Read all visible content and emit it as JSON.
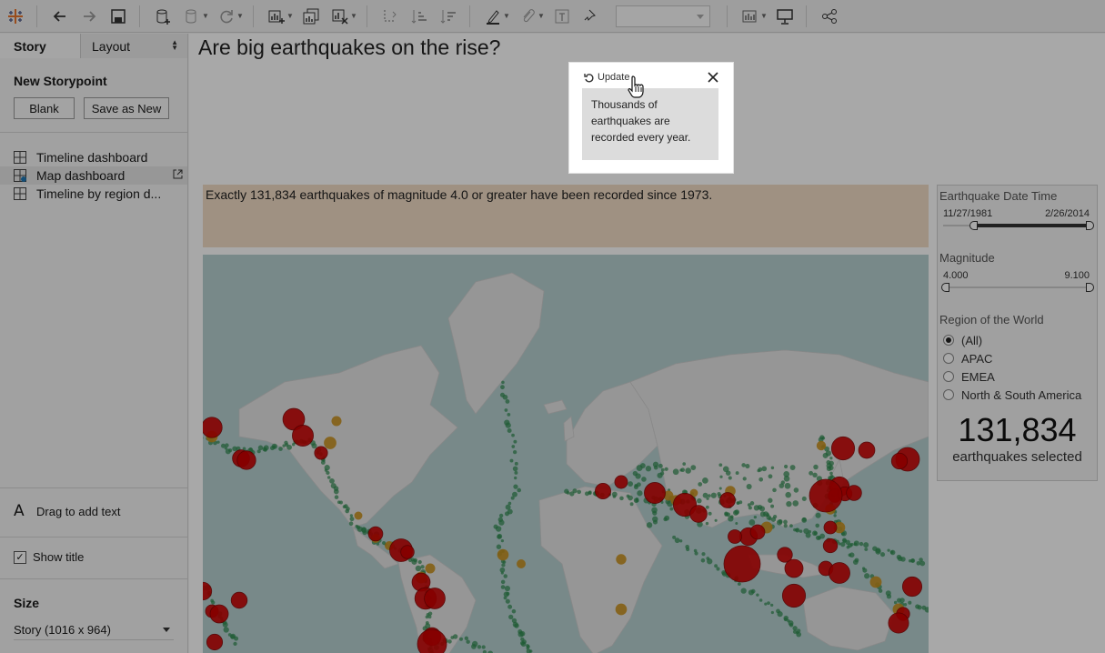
{
  "toolbar": {
    "icons": [
      "tableau-logo-icon",
      "undo-icon",
      "redo-icon",
      "save-icon",
      "new-data-source-icon",
      "pause-updates-icon",
      "refresh-icon",
      "new-worksheet-icon",
      "duplicate-sheet-icon",
      "clear-sheet-icon",
      "swap-rows-columns-icon",
      "sort-ascending-icon",
      "sort-descending-icon",
      "highlight-icon",
      "group-members-icon",
      "show-labels-icon",
      "fix-axes-icon",
      "fit-select",
      "show-me-icon",
      "presentation-mode-icon",
      "share-icon"
    ]
  },
  "left_pane": {
    "tabs": {
      "story": "Story",
      "layout": "Layout"
    },
    "new_storypoint": {
      "title": "New Storypoint",
      "blank": "Blank",
      "save_as_new": "Save as New"
    },
    "sheets": [
      {
        "label": "Timeline dashboard"
      },
      {
        "label": "Map dashboard"
      },
      {
        "label": "Timeline by region d..."
      }
    ],
    "drag_text": "Drag to add text",
    "show_title": "Show title",
    "show_title_checked": true,
    "size": {
      "title": "Size",
      "value": "Story (1016 x 964)"
    }
  },
  "story": {
    "title": "Are big earthquakes on the rise?",
    "caption_text": "Exactly 131,834 earthquakes of magnitude 4.0 or greater have been recorded since 1973.",
    "popup": {
      "update_label": "Update",
      "text": "Thousands of earthquakes are recorded every year."
    },
    "filters": {
      "date_title": "Earthquake Date Time",
      "date_min": "11/27/1981",
      "date_max": "2/26/2014",
      "date_level_min": 0.18,
      "mag_title": "Magnitude",
      "mag_min": "4.000",
      "mag_max": "9.100",
      "region_title": "Region of the World",
      "regions": [
        "(All)",
        "APAC",
        "EMEA",
        "North & South America"
      ],
      "selected_region": "(All)"
    },
    "kpi": {
      "value": "131,834",
      "caption": "earthquakes selected"
    }
  },
  "colors": {
    "caption_bg": "#f2dcc5",
    "ocean": "#b7d1d1",
    "land": "#e4e4e4",
    "quake_small": "#2e8a4e",
    "quake_mid": "#c8901e",
    "quake_large": "#cc0000"
  }
}
